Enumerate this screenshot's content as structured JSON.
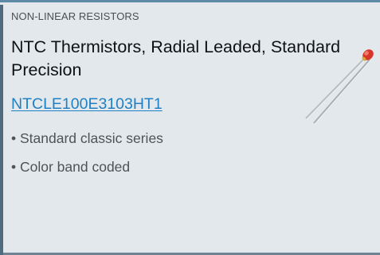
{
  "card": {
    "category": "NON-LINEAR RESISTORS",
    "title": "NTC Thermistors, Radial Leaded, Standard Precision",
    "part_number": "NTCLE100E3103HT1",
    "features": [
      "• Standard classic series",
      "• Color band coded"
    ],
    "product_image_icon": "radial-leaded-thermistor-icon"
  },
  "colors": {
    "card_background": "#e3e8ec",
    "page_background": "#6f8392",
    "top_border": "#5f8aa6",
    "link": "#1f80c3",
    "title_text": "#0f1114",
    "thermistor_body": "#d9342b"
  }
}
